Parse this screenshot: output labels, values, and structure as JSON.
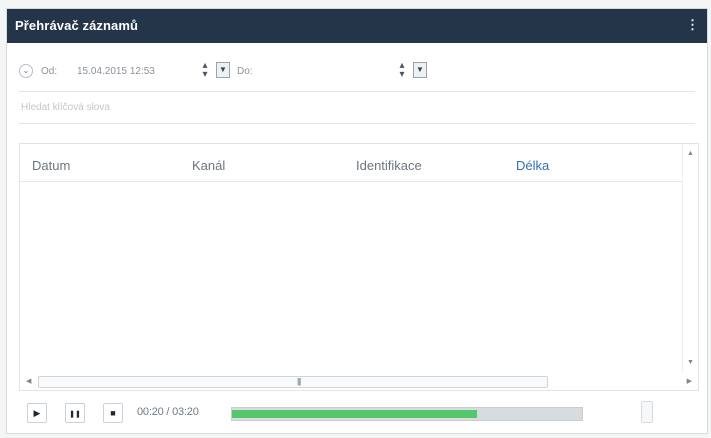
{
  "window": {
    "title": "Přehrávač záznamů",
    "menu_glyph": "⋮"
  },
  "filter": {
    "from_label": "Od:",
    "from_value": "15.04.2015 12:53",
    "to_label": "Do:",
    "to_value": ""
  },
  "search": {
    "placeholder": "Hledat klíčová slova",
    "value": ""
  },
  "table": {
    "columns": [
      {
        "label": "Datum",
        "sorted": false
      },
      {
        "label": "Kanál",
        "sorted": false
      },
      {
        "label": "Identifikace",
        "sorted": false
      },
      {
        "label": "Délka",
        "sorted": true
      }
    ],
    "rows": []
  },
  "player": {
    "play_icon": "▶",
    "pause_icon": "❚❚",
    "stop_icon": "■",
    "timecode": "00:20 / 03:20",
    "progress_fraction": 0.7
  },
  "colors": {
    "titlebar": "#243549",
    "progress_fill": "#53c76a",
    "sorted_header": "#2f6fb5"
  }
}
